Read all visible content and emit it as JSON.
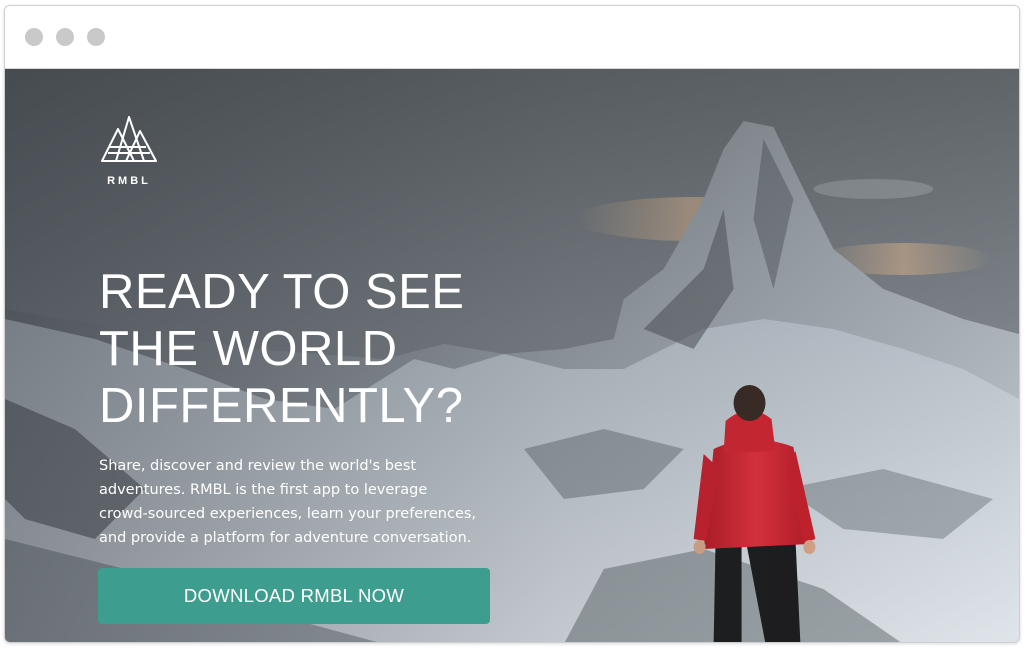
{
  "hero": {
    "logo_text": "RMBL",
    "headline": [
      "READY TO SEE",
      "THE WORLD",
      "DIFFERENTLY?"
    ],
    "description": "Share, discover and review the world's best adventures. RMBL is the first app to leverage crowd-sourced experiences, learn your preferences, and provide a platform for adventure conversation.",
    "cta_label": "DOWNLOAD RMBL NOW"
  },
  "colors": {
    "accent": "#3d9e8f",
    "jacket": "#d8232f",
    "window_dot": "#c9c9c9"
  }
}
